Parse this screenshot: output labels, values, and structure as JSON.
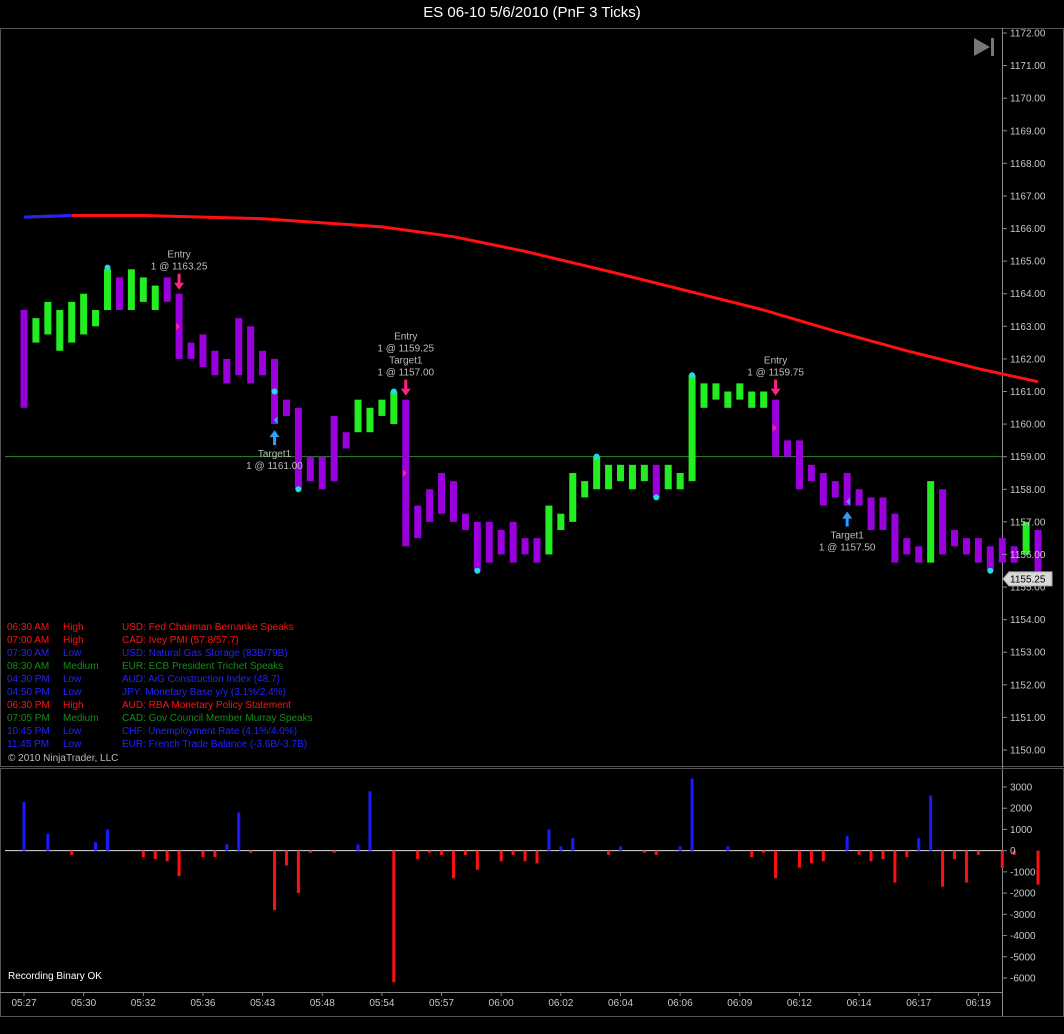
{
  "window": {
    "title": "ES 06-10  5/6/2010 (PnF 3 Ticks)",
    "copyright": "© 2010 NinjaTrader, LLC",
    "status": "Recording Binary OK"
  },
  "colors": {
    "up_bar": "#22ee22",
    "down_bar": "#9900dd",
    "ma_line": "#ff1111",
    "ma_start": "#2222ff",
    "hline": "#2a8a2a",
    "vol_pos": "#1a1aff",
    "vol_neg": "#ff1111",
    "arrow_entry": "#ff2288",
    "arrow_target": "#2a9fff",
    "dot": "#22dddd",
    "high": "#ff1111",
    "medium": "#1a8a1a",
    "low": "#2222ff"
  },
  "chart_data": [
    {
      "type": "candlestick",
      "subtype": "point-and-figure",
      "yaxis": {
        "min": 1150.0,
        "max": 1172.0,
        "ticks": [
          "1150.00",
          "1151.00",
          "1152.00",
          "1153.00",
          "1154.00",
          "1155.00",
          "1156.00",
          "1157.00",
          "1158.00",
          "1159.00",
          "1160.00",
          "1161.00",
          "1162.00",
          "1163.00",
          "1164.00",
          "1165.00",
          "1166.00",
          "1167.00",
          "1168.00",
          "1169.00",
          "1170.00",
          "1171.00",
          "1172.00"
        ]
      },
      "last_price": "1155.25",
      "horizontal_line": 1159.0,
      "bars": [
        {
          "o": 1163.5,
          "c": 1160.5,
          "d": "d"
        },
        {
          "o": 1162.5,
          "c": 1163.25,
          "d": "u"
        },
        {
          "o": 1162.75,
          "c": 1163.75,
          "d": "u"
        },
        {
          "o": 1162.25,
          "c": 1163.5,
          "d": "u"
        },
        {
          "o": 1162.5,
          "c": 1163.75,
          "d": "u"
        },
        {
          "o": 1162.75,
          "c": 1164.0,
          "d": "u"
        },
        {
          "o": 1163.0,
          "c": 1163.5,
          "d": "u"
        },
        {
          "o": 1163.5,
          "c": 1164.75,
          "d": "u"
        },
        {
          "o": 1164.5,
          "c": 1163.5,
          "d": "d"
        },
        {
          "o": 1163.5,
          "c": 1164.75,
          "d": "u"
        },
        {
          "o": 1163.75,
          "c": 1164.5,
          "d": "u"
        },
        {
          "o": 1163.5,
          "c": 1164.25,
          "d": "u"
        },
        {
          "o": 1164.5,
          "c": 1163.75,
          "d": "d"
        },
        {
          "o": 1164.0,
          "c": 1162.0,
          "d": "d"
        },
        {
          "o": 1162.5,
          "c": 1162.0,
          "d": "d"
        },
        {
          "o": 1162.75,
          "c": 1161.75,
          "d": "d"
        },
        {
          "o": 1162.25,
          "c": 1161.5,
          "d": "d"
        },
        {
          "o": 1162.0,
          "c": 1161.25,
          "d": "d"
        },
        {
          "o": 1163.25,
          "c": 1161.5,
          "d": "d"
        },
        {
          "o": 1163.0,
          "c": 1161.25,
          "d": "d"
        },
        {
          "o": 1162.25,
          "c": 1161.5,
          "d": "d"
        },
        {
          "o": 1162.0,
          "c": 1160.0,
          "d": "d"
        },
        {
          "o": 1160.75,
          "c": 1160.25,
          "d": "d"
        },
        {
          "o": 1160.5,
          "c": 1158.0,
          "d": "d"
        },
        {
          "o": 1159.0,
          "c": 1158.25,
          "d": "d"
        },
        {
          "o": 1159.0,
          "c": 1158.0,
          "d": "d"
        },
        {
          "o": 1160.25,
          "c": 1158.25,
          "d": "d"
        },
        {
          "o": 1159.75,
          "c": 1159.25,
          "d": "d"
        },
        {
          "o": 1159.75,
          "c": 1160.75,
          "d": "u"
        },
        {
          "o": 1159.75,
          "c": 1160.5,
          "d": "u"
        },
        {
          "o": 1160.25,
          "c": 1160.75,
          "d": "u"
        },
        {
          "o": 1160.0,
          "c": 1161.0,
          "d": "u"
        },
        {
          "o": 1160.75,
          "c": 1156.25,
          "d": "d"
        },
        {
          "o": 1157.5,
          "c": 1156.5,
          "d": "d"
        },
        {
          "o": 1158.0,
          "c": 1157.0,
          "d": "d"
        },
        {
          "o": 1158.5,
          "c": 1157.25,
          "d": "d"
        },
        {
          "o": 1158.25,
          "c": 1157.0,
          "d": "d"
        },
        {
          "o": 1157.25,
          "c": 1156.75,
          "d": "d"
        },
        {
          "o": 1157.0,
          "c": 1155.5,
          "d": "d"
        },
        {
          "o": 1157.0,
          "c": 1155.75,
          "d": "d"
        },
        {
          "o": 1156.75,
          "c": 1156.0,
          "d": "d"
        },
        {
          "o": 1157.0,
          "c": 1155.75,
          "d": "d"
        },
        {
          "o": 1156.5,
          "c": 1156.0,
          "d": "d"
        },
        {
          "o": 1156.5,
          "c": 1155.75,
          "d": "d"
        },
        {
          "o": 1156.0,
          "c": 1157.5,
          "d": "u"
        },
        {
          "o": 1156.75,
          "c": 1157.25,
          "d": "u"
        },
        {
          "o": 1157.0,
          "c": 1158.5,
          "d": "u"
        },
        {
          "o": 1157.75,
          "c": 1158.25,
          "d": "u"
        },
        {
          "o": 1158.0,
          "c": 1159.0,
          "d": "u"
        },
        {
          "o": 1158.0,
          "c": 1158.75,
          "d": "u"
        },
        {
          "o": 1158.25,
          "c": 1158.75,
          "d": "u"
        },
        {
          "o": 1158.0,
          "c": 1158.75,
          "d": "u"
        },
        {
          "o": 1158.25,
          "c": 1158.75,
          "d": "u"
        },
        {
          "o": 1158.75,
          "c": 1157.75,
          "d": "d"
        },
        {
          "o": 1158.0,
          "c": 1158.75,
          "d": "u"
        },
        {
          "o": 1158.0,
          "c": 1158.5,
          "d": "u"
        },
        {
          "o": 1158.25,
          "c": 1161.5,
          "d": "u"
        },
        {
          "o": 1160.5,
          "c": 1161.25,
          "d": "u"
        },
        {
          "o": 1160.75,
          "c": 1161.25,
          "d": "u"
        },
        {
          "o": 1160.5,
          "c": 1161.0,
          "d": "u"
        },
        {
          "o": 1160.75,
          "c": 1161.25,
          "d": "u"
        },
        {
          "o": 1160.5,
          "c": 1161.0,
          "d": "u"
        },
        {
          "o": 1160.5,
          "c": 1161.0,
          "d": "u"
        },
        {
          "o": 1160.75,
          "c": 1159.0,
          "d": "d"
        },
        {
          "o": 1159.5,
          "c": 1159.0,
          "d": "d"
        },
        {
          "o": 1159.5,
          "c": 1158.0,
          "d": "d"
        },
        {
          "o": 1158.75,
          "c": 1158.25,
          "d": "d"
        },
        {
          "o": 1158.5,
          "c": 1157.5,
          "d": "d"
        },
        {
          "o": 1158.25,
          "c": 1157.75,
          "d": "d"
        },
        {
          "o": 1158.5,
          "c": 1157.5,
          "d": "d"
        },
        {
          "o": 1158.0,
          "c": 1157.5,
          "d": "d"
        },
        {
          "o": 1157.75,
          "c": 1156.75,
          "d": "d"
        },
        {
          "o": 1157.75,
          "c": 1156.75,
          "d": "d"
        },
        {
          "o": 1157.25,
          "c": 1155.75,
          "d": "d"
        },
        {
          "o": 1156.5,
          "c": 1156.0,
          "d": "d"
        },
        {
          "o": 1156.25,
          "c": 1155.75,
          "d": "d"
        },
        {
          "o": 1155.75,
          "c": 1158.25,
          "d": "u"
        },
        {
          "o": 1158.0,
          "c": 1156.0,
          "d": "d"
        },
        {
          "o": 1156.75,
          "c": 1156.25,
          "d": "d"
        },
        {
          "o": 1156.5,
          "c": 1156.0,
          "d": "d"
        },
        {
          "o": 1156.5,
          "c": 1155.75,
          "d": "d"
        },
        {
          "o": 1156.25,
          "c": 1155.5,
          "d": "d"
        },
        {
          "o": 1156.5,
          "c": 1155.75,
          "d": "d"
        },
        {
          "o": 1156.25,
          "c": 1155.75,
          "d": "d"
        },
        {
          "o": 1156.0,
          "c": 1157.0,
          "d": "u"
        },
        {
          "o": 1156.75,
          "c": 1155.25,
          "d": "d"
        }
      ],
      "moving_average": [
        {
          "i": 0,
          "v": 1166.35
        },
        {
          "i": 4,
          "v": 1166.4
        },
        {
          "i": 10,
          "v": 1166.4
        },
        {
          "i": 20,
          "v": 1166.3
        },
        {
          "i": 30,
          "v": 1166.05
        },
        {
          "i": 36,
          "v": 1165.75
        },
        {
          "i": 42,
          "v": 1165.3
        },
        {
          "i": 50,
          "v": 1164.6
        },
        {
          "i": 56,
          "v": 1164.05
        },
        {
          "i": 62,
          "v": 1163.5
        },
        {
          "i": 68,
          "v": 1162.85
        },
        {
          "i": 74,
          "v": 1162.25
        },
        {
          "i": 80,
          "v": 1161.7
        },
        {
          "i": 85,
          "v": 1161.3
        }
      ],
      "dots": [
        {
          "i": 7,
          "v": 1164.8
        },
        {
          "i": 21,
          "v": 1161.0
        },
        {
          "i": 23,
          "v": 1158.0
        },
        {
          "i": 31,
          "v": 1161.0
        },
        {
          "i": 38,
          "v": 1155.5
        },
        {
          "i": 48,
          "v": 1159.0
        },
        {
          "i": 53,
          "v": 1157.75
        },
        {
          "i": 56,
          "v": 1161.5
        },
        {
          "i": 81,
          "v": 1155.5
        }
      ],
      "trades": [
        {
          "bar": 13,
          "kind": "Entry",
          "dir": "short",
          "label": "Entry",
          "detail": "1 @ 1163.25"
        },
        {
          "bar": 21,
          "kind": "Target1",
          "dir": "long",
          "label": "Target1",
          "detail": "1 @ 1161.00"
        },
        {
          "bar": 32,
          "kind": "Entry+Target1",
          "dir": "short",
          "label": "Entry",
          "detail": "1 @ 1159.25",
          "label2": "Target1",
          "detail2": "1 @ 1157.00"
        },
        {
          "bar": 63,
          "kind": "Entry",
          "dir": "short",
          "label": "Entry",
          "detail": "1 @ 1159.75"
        },
        {
          "bar": 69,
          "kind": "Target1",
          "dir": "long",
          "label": "Target1",
          "detail": "1 @ 1157.50"
        }
      ],
      "xaxis": {
        "labels": [
          {
            "bar": 0,
            "text": "05:27"
          },
          {
            "bar": 5,
            "text": "05:30"
          },
          {
            "bar": 10,
            "text": "05:32"
          },
          {
            "bar": 15,
            "text": "05:36"
          },
          {
            "bar": 20,
            "text": "05:43"
          },
          {
            "bar": 25,
            "text": "05:48"
          },
          {
            "bar": 30,
            "text": "05:54"
          },
          {
            "bar": 35,
            "text": "05:57"
          },
          {
            "bar": 40,
            "text": "06:00"
          },
          {
            "bar": 45,
            "text": "06:02"
          },
          {
            "bar": 50,
            "text": "06:04"
          },
          {
            "bar": 55,
            "text": "06:06"
          },
          {
            "bar": 60,
            "text": "06:09"
          },
          {
            "bar": 65,
            "text": "06:12"
          },
          {
            "bar": 70,
            "text": "06:14"
          },
          {
            "bar": 75,
            "text": "06:17"
          },
          {
            "bar": 80,
            "text": "06:19"
          }
        ]
      }
    },
    {
      "type": "bar",
      "name": "volume delta",
      "yaxis": {
        "min": -6000,
        "max": 3000,
        "ticks": [
          "3000",
          "2000",
          "1000",
          "0",
          "-1000",
          "-2000",
          "-3000",
          "-4000",
          "-5000",
          "-6000"
        ]
      },
      "values": [
        2300,
        0,
        800,
        0,
        -200,
        0,
        400,
        1000,
        0,
        0,
        -300,
        -400,
        -500,
        -1200,
        0,
        -300,
        -300,
        300,
        1800,
        -100,
        0,
        -2800,
        -700,
        -2000,
        -100,
        0,
        -100,
        0,
        300,
        2800,
        0,
        -6200,
        0,
        -400,
        -100,
        -200,
        -1300,
        -200,
        -900,
        0,
        -500,
        -200,
        -500,
        -600,
        1000,
        200,
        600,
        0,
        0,
        -200,
        200,
        0,
        -100,
        -200,
        0,
        200,
        3400,
        0,
        0,
        200,
        0,
        -300,
        -100,
        -1300,
        0,
        -800,
        -600,
        -500,
        0,
        700,
        -200,
        -500,
        -400,
        -1500,
        -300,
        600,
        2600,
        -1700,
        -400,
        -1500,
        -200,
        0,
        -800,
        -200,
        0,
        -1600
      ],
      "xaxis_labels": [
        "05:27",
        "05:30",
        "05:32",
        "05:36",
        "05:43",
        "05:48",
        "05:54",
        "05:57",
        "06:00",
        "06:02",
        "06:04",
        "06:06",
        "06:09",
        "06:12",
        "06:14",
        "06:17",
        "06:19"
      ]
    }
  ],
  "news": [
    {
      "time": "06:30 AM",
      "impact": "High",
      "event": "USD: Fed Chairman Bernanke Speaks"
    },
    {
      "time": "07:00 AM",
      "impact": "High",
      "event": "CAD: Ivey PMI (57.8/57.7)"
    },
    {
      "time": "07:30 AM",
      "impact": "Low",
      "event": "USD: Natural Gas Storage (83B/79B)"
    },
    {
      "time": "08:30 AM",
      "impact": "Medium",
      "event": "EUR: ECB President Trichet Speaks"
    },
    {
      "time": "04:30 PM",
      "impact": "Low",
      "event": "AUD: AiG Construction Index (48.7)"
    },
    {
      "time": "04:50 PM",
      "impact": "Low",
      "event": "JPY: Monetary Base y/y (3.1%/2.4%)"
    },
    {
      "time": "06:30 PM",
      "impact": "High",
      "event": "AUD: RBA Monetary Policy Statement"
    },
    {
      "time": "07:05 PM",
      "impact": "Medium",
      "event": "CAD: Gov Council Member Murray Speaks"
    },
    {
      "time": "10:45 PM",
      "impact": "Low",
      "event": "CHF: Unemployment Rate (4.1%/4.0%)"
    },
    {
      "time": "11:45 PM",
      "impact": "Low",
      "event": "EUR: French Trade Balance (-3.6B/-3.7B)"
    }
  ]
}
